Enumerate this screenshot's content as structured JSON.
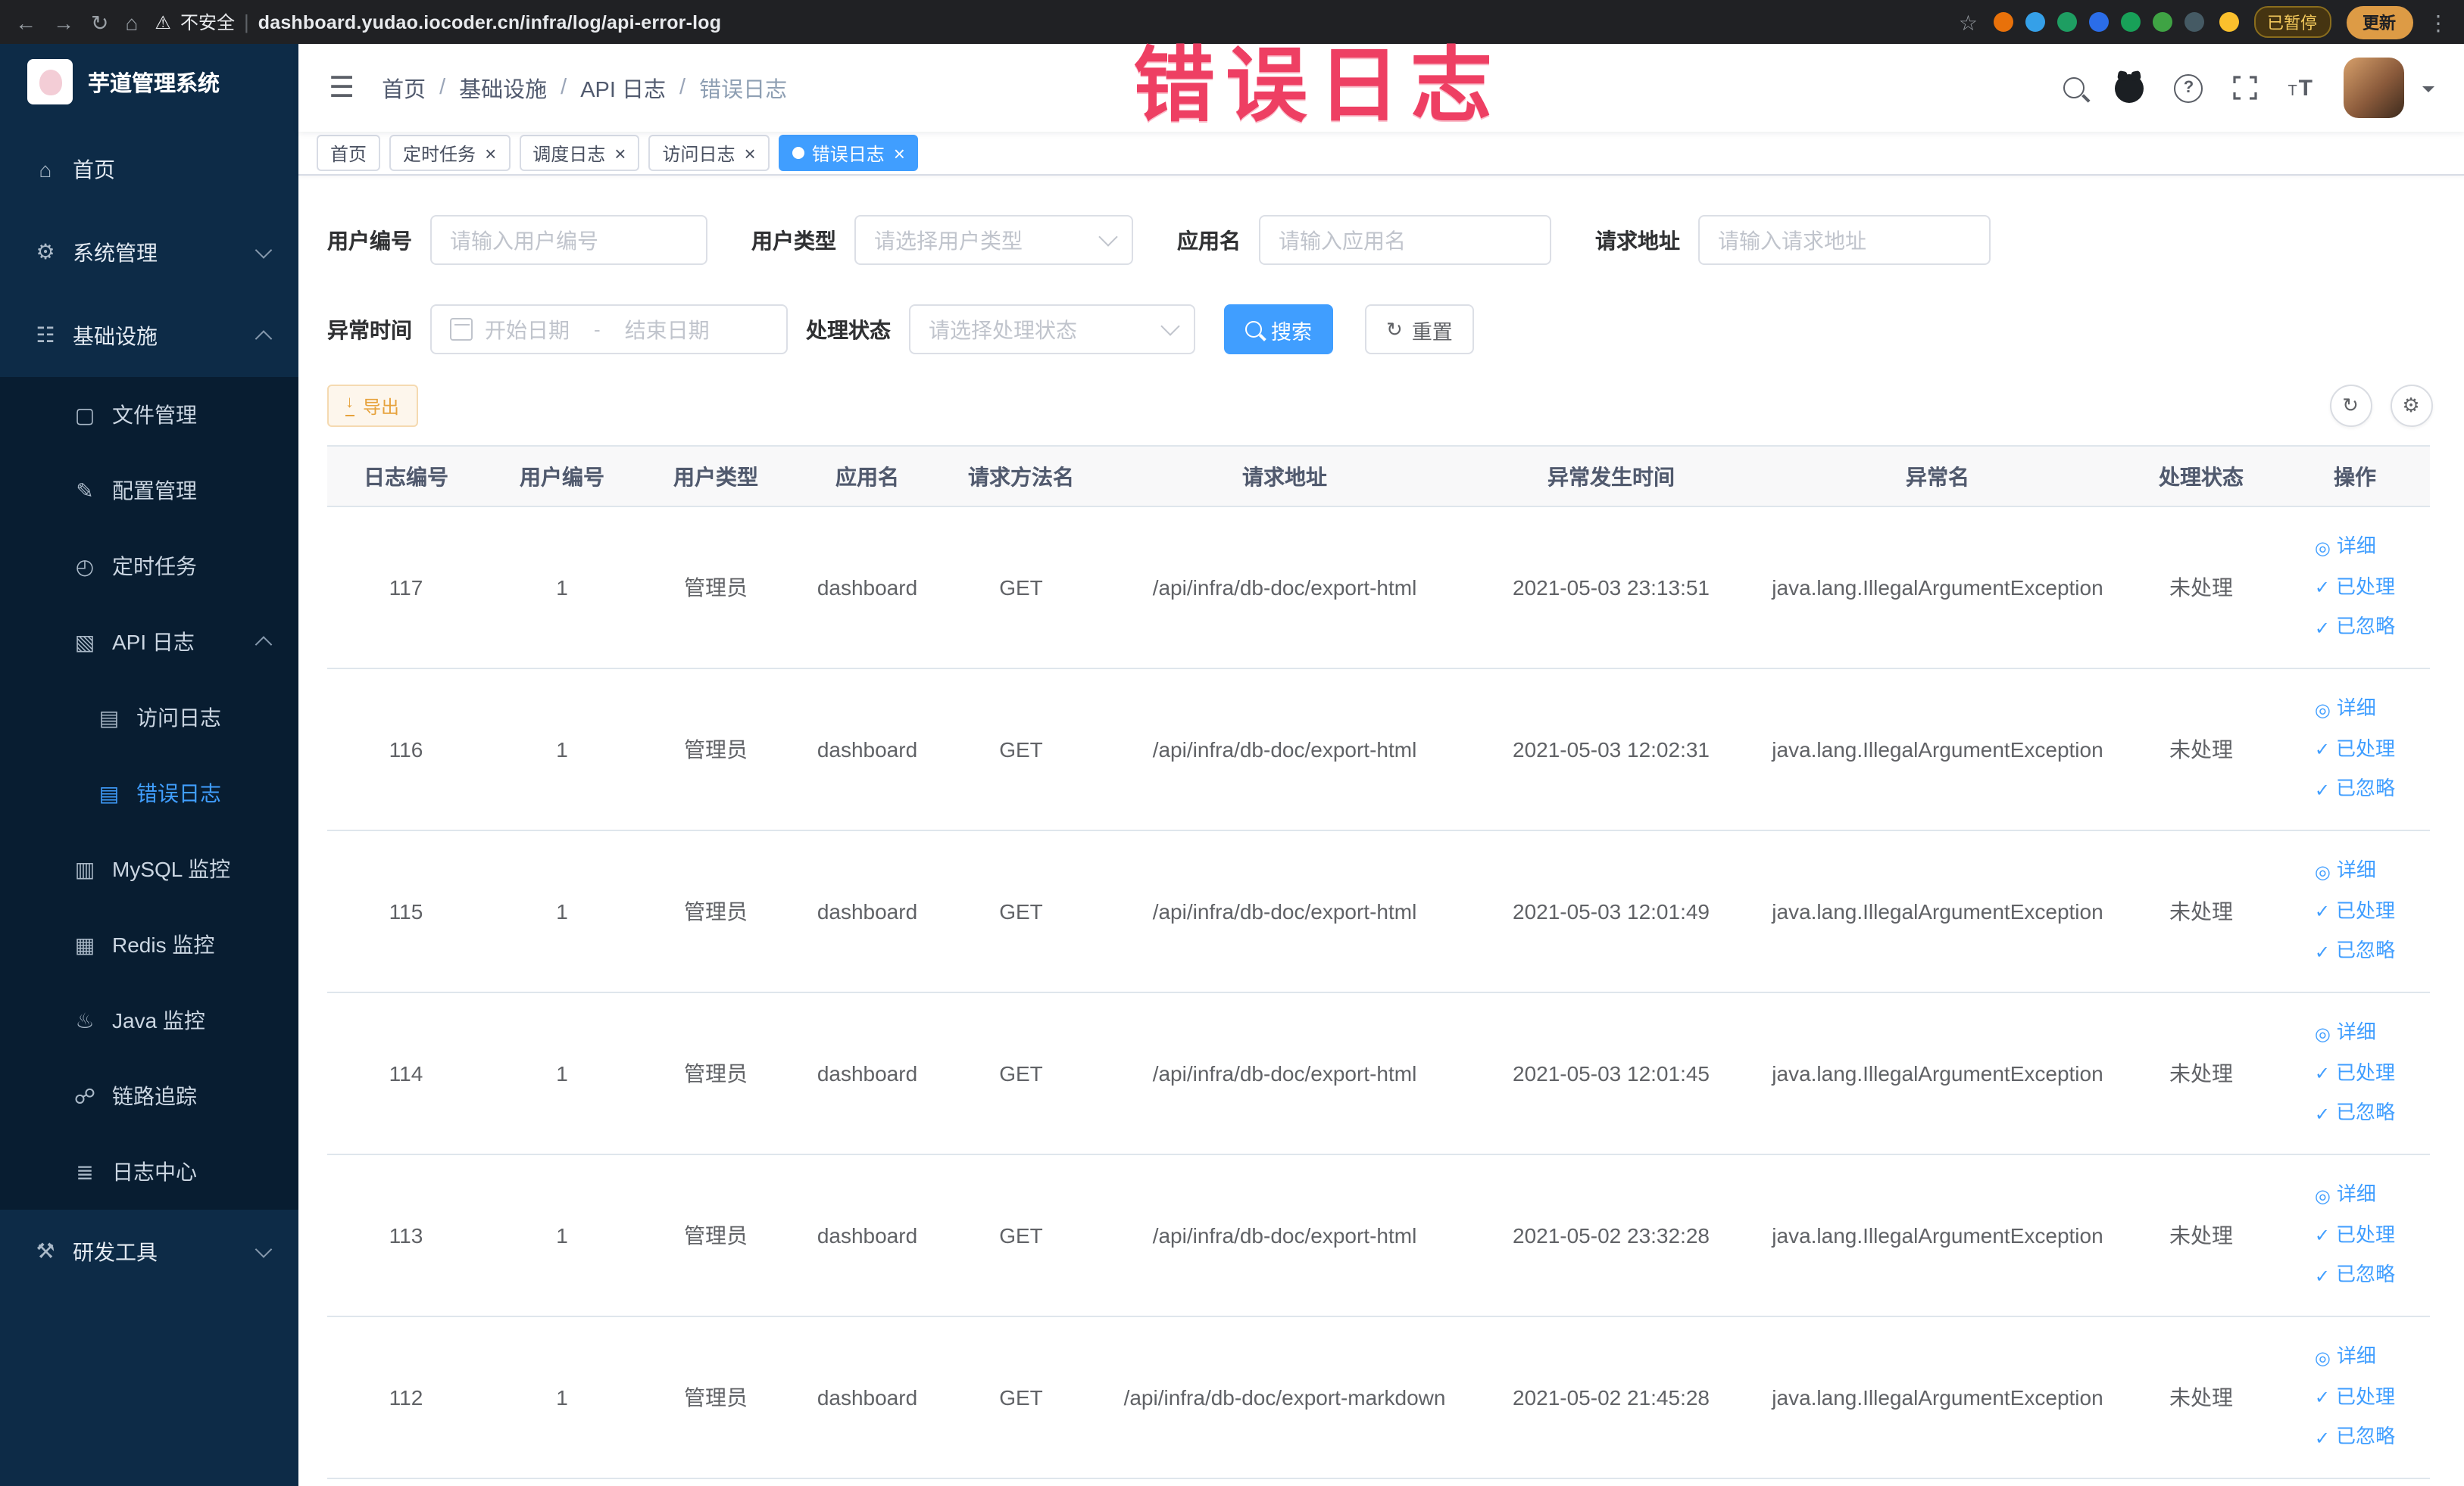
{
  "browser": {
    "security_label": "不安全",
    "url": "dashboard.yudao.iocoder.cn/infra/log/api-error-log",
    "paused_badge": "已暂停",
    "update_button": "更新",
    "extension_colors": [
      "#e8710a",
      "#35a0e8",
      "#1e9e62",
      "#2b6de8",
      "#18a058",
      "#3fa344",
      "#455a64"
    ]
  },
  "watermark": "错误日志",
  "sidebar": {
    "logo_title": "芋道管理系统",
    "menu": [
      {
        "id": "home",
        "label": "首页",
        "icon": "home-icon",
        "level": 1
      },
      {
        "id": "system",
        "label": "系统管理",
        "icon": "gear-icon",
        "level": 1,
        "expand": "down"
      },
      {
        "id": "infra",
        "label": "基础设施",
        "icon": "infrastructure-icon",
        "level": 1,
        "expand": "up"
      },
      {
        "id": "file",
        "label": "文件管理",
        "icon": "folder-icon",
        "level": 2
      },
      {
        "id": "config",
        "label": "配置管理",
        "icon": "edit-icon",
        "level": 2
      },
      {
        "id": "job",
        "label": "定时任务",
        "icon": "clock-icon",
        "level": 2
      },
      {
        "id": "api-log",
        "label": "API 日志",
        "icon": "api-log-icon",
        "level": 2,
        "expand": "up"
      },
      {
        "id": "access-log",
        "label": "访问日志",
        "icon": "doc-icon",
        "level": 3
      },
      {
        "id": "error-log",
        "label": "错误日志",
        "icon": "doc-icon",
        "level": 3,
        "active": true
      },
      {
        "id": "mysql",
        "label": "MySQL 监控",
        "icon": "mysql-icon",
        "level": 2
      },
      {
        "id": "redis",
        "label": "Redis 监控",
        "icon": "redis-icon",
        "level": 2
      },
      {
        "id": "java",
        "label": "Java 监控",
        "icon": "java-icon",
        "level": 2
      },
      {
        "id": "trace",
        "label": "链路追踪",
        "icon": "trace-icon",
        "level": 2
      },
      {
        "id": "log-center",
        "label": "日志中心",
        "icon": "log-center-icon",
        "level": 2
      },
      {
        "id": "dev-tools",
        "label": "研发工具",
        "icon": "tools-icon",
        "level": 1,
        "expand": "down"
      }
    ]
  },
  "navbar": {
    "breadcrumb": [
      "首页",
      "基础设施",
      "API 日志",
      "错误日志"
    ]
  },
  "tabs": [
    {
      "id": "home",
      "label": "首页",
      "closable": false,
      "active": false
    },
    {
      "id": "job",
      "label": "定时任务",
      "closable": true,
      "active": false
    },
    {
      "id": "job-log",
      "label": "调度日志",
      "closable": true,
      "active": false
    },
    {
      "id": "access-log",
      "label": "访问日志",
      "closable": true,
      "active": false
    },
    {
      "id": "error-log",
      "label": "错误日志",
      "closable": true,
      "active": true
    }
  ],
  "filters": {
    "user_id": {
      "label": "用户编号",
      "placeholder": "请输入用户编号"
    },
    "user_type": {
      "label": "用户类型",
      "placeholder": "请选择用户类型"
    },
    "app_name": {
      "label": "应用名",
      "placeholder": "请输入应用名"
    },
    "request_url": {
      "label": "请求地址",
      "placeholder": "请输入请求地址"
    },
    "exception_time": {
      "label": "异常时间",
      "start_placeholder": "开始日期",
      "separator": "-",
      "end_placeholder": "结束日期"
    },
    "process_status": {
      "label": "处理状态",
      "placeholder": "请选择处理状态"
    },
    "search_button": "搜索",
    "reset_button": "重置"
  },
  "toolbar": {
    "export_button": "导出"
  },
  "table": {
    "columns": [
      "日志编号",
      "用户编号",
      "用户类型",
      "应用名",
      "请求方法名",
      "请求地址",
      "异常发生时间",
      "异常名",
      "处理状态",
      "操作"
    ],
    "actions": [
      "详细",
      "已处理",
      "已忽略"
    ],
    "rows": [
      {
        "id": "117",
        "user_id": "1",
        "user_type": "管理员",
        "app": "dashboard",
        "method": "GET",
        "url": "/api/infra/db-doc/export-html",
        "time": "2021-05-03 23:13:51",
        "exception": "java.lang.IllegalArgumentException",
        "status": "未处理"
      },
      {
        "id": "116",
        "user_id": "1",
        "user_type": "管理员",
        "app": "dashboard",
        "method": "GET",
        "url": "/api/infra/db-doc/export-html",
        "time": "2021-05-03 12:02:31",
        "exception": "java.lang.IllegalArgumentException",
        "status": "未处理"
      },
      {
        "id": "115",
        "user_id": "1",
        "user_type": "管理员",
        "app": "dashboard",
        "method": "GET",
        "url": "/api/infra/db-doc/export-html",
        "time": "2021-05-03 12:01:49",
        "exception": "java.lang.IllegalArgumentException",
        "status": "未处理"
      },
      {
        "id": "114",
        "user_id": "1",
        "user_type": "管理员",
        "app": "dashboard",
        "method": "GET",
        "url": "/api/infra/db-doc/export-html",
        "time": "2021-05-03 12:01:45",
        "exception": "java.lang.IllegalArgumentException",
        "status": "未处理"
      },
      {
        "id": "113",
        "user_id": "1",
        "user_type": "管理员",
        "app": "dashboard",
        "method": "GET",
        "url": "/api/infra/db-doc/export-html",
        "time": "2021-05-02 23:32:28",
        "exception": "java.lang.IllegalArgumentException",
        "status": "未处理"
      },
      {
        "id": "112",
        "user_id": "1",
        "user_type": "管理员",
        "app": "dashboard",
        "method": "GET",
        "url": "/api/infra/db-doc/export-markdown",
        "time": "2021-05-02 21:45:28",
        "exception": "java.lang.IllegalArgumentException",
        "status": "未处理"
      }
    ]
  },
  "colors": {
    "accent": "#409eff",
    "warning": "#e6a23c",
    "watermark": "#ee3f63",
    "sidebar_bg": "#0d2b47"
  }
}
